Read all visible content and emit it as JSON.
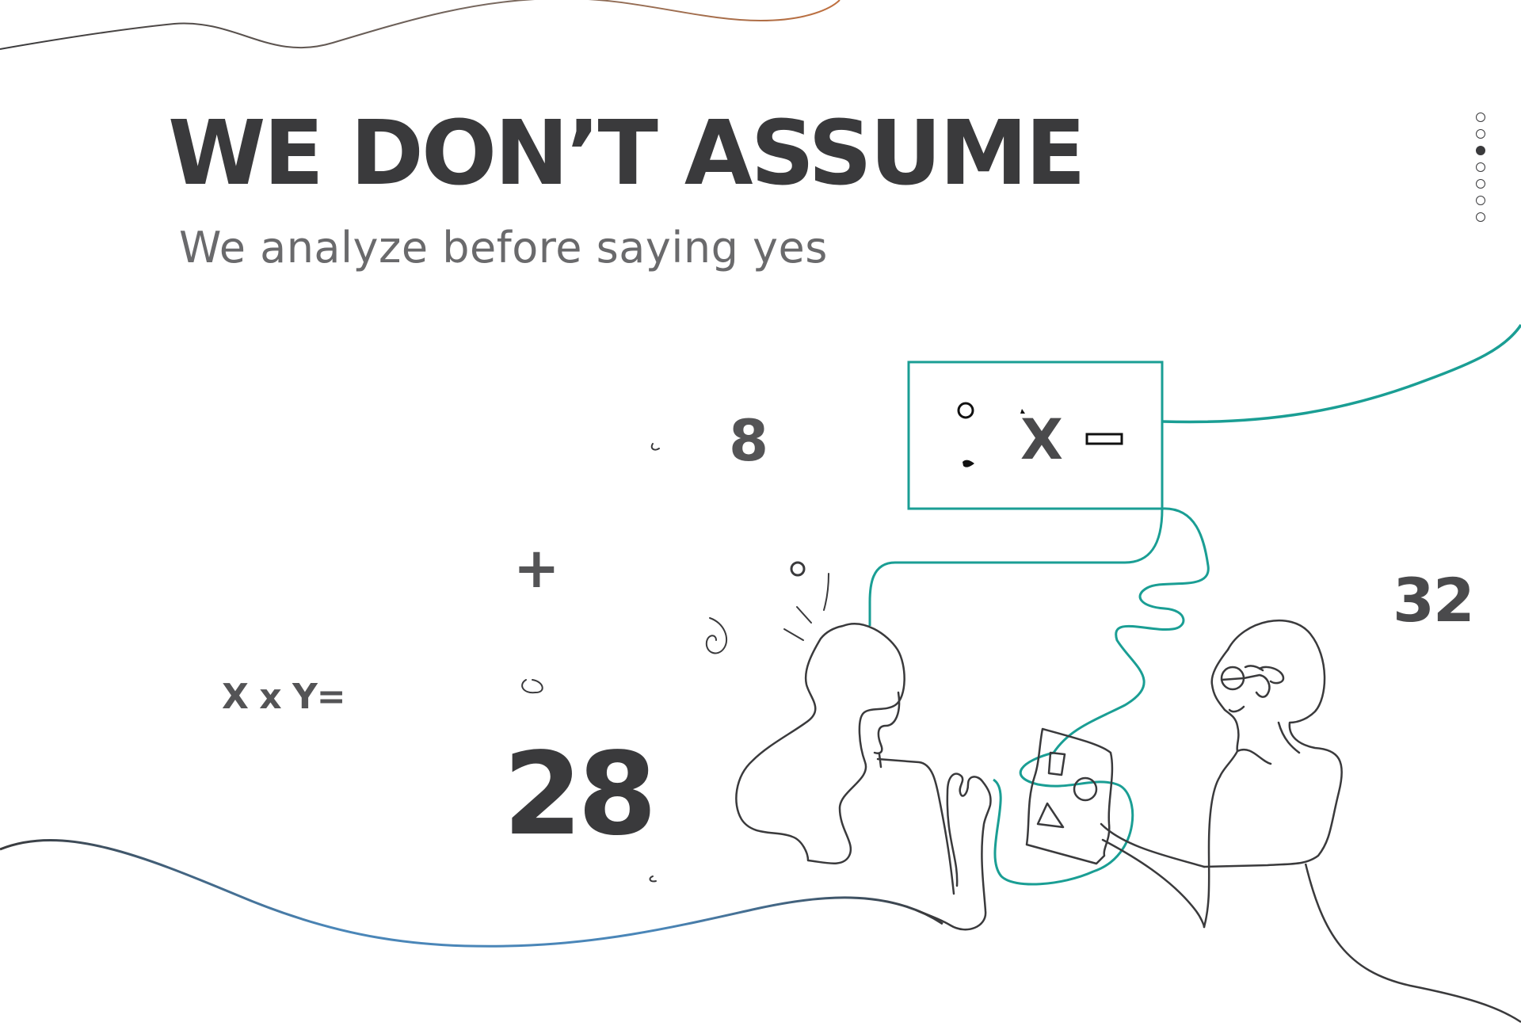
{
  "slide": {
    "headline": "WE DON’T ASSUME",
    "subtitle": "We analyze before saying yes"
  },
  "pager": {
    "dots": 7,
    "active_index": 2
  },
  "illustration": {
    "numbers": {
      "eight": "8",
      "thirty_two": "32",
      "twenty_eight": "28",
      "plus": "+",
      "equation": "X x Y=",
      "board_symbol": "X"
    }
  },
  "colors": {
    "text_dark": "#3a3a3c",
    "text_light": "#6a6a6c",
    "teal_accent": "#1a9e94",
    "wave_blue": "#4a86b8",
    "wave_copper": "#b5704a"
  }
}
